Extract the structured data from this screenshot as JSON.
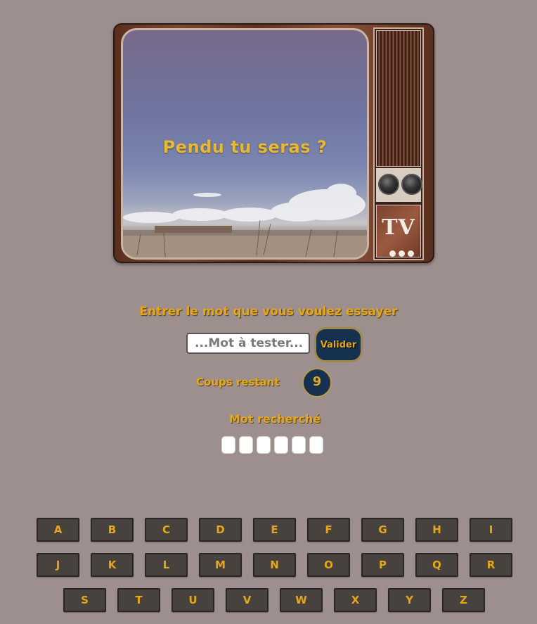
{
  "screen": {
    "title": "Pendu tu seras ?"
  },
  "tv": {
    "logo": "TV"
  },
  "form": {
    "prompt": "Entrer le mot que vous voulez essayer",
    "input_placeholder": "...Mot à tester...",
    "validate_label": "Valider"
  },
  "status": {
    "coups_label": "Coups restant",
    "coups_value": "9",
    "mot_label": "Mot recherché",
    "word_length": 6
  },
  "keyboard": {
    "rows": [
      [
        "A",
        "B",
        "C",
        "D",
        "E",
        "F",
        "G",
        "H",
        "I"
      ],
      [
        "J",
        "K",
        "L",
        "M",
        "N",
        "O",
        "P",
        "Q",
        "R"
      ],
      [
        "S",
        "T",
        "U",
        "V",
        "W",
        "X",
        "Y",
        "Z"
      ]
    ]
  },
  "colors": {
    "background": "#9d8f8e",
    "accent": "#e5a719",
    "navy": "#163050",
    "key": "#48423f"
  }
}
